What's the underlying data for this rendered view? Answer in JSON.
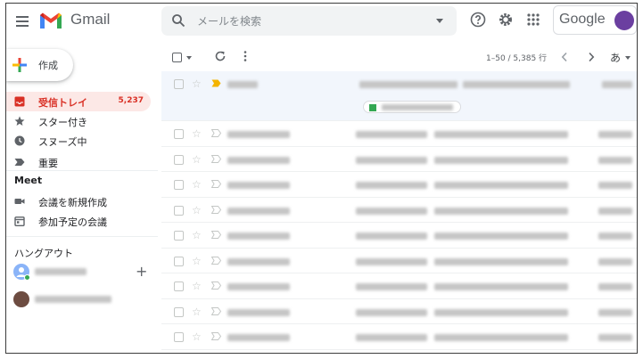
{
  "app": {
    "name": "Gmail"
  },
  "search": {
    "placeholder": "メールを検索"
  },
  "account": {
    "brand": "Google",
    "avatar_initial": ""
  },
  "sidebar": {
    "compose_label": "作成",
    "items": [
      {
        "label": "受信トレイ",
        "count": "5,237",
        "active": true,
        "icon": "inbox-icon"
      },
      {
        "label": "スター付き",
        "icon": "star-icon"
      },
      {
        "label": "スヌーズ中",
        "icon": "clock-icon"
      },
      {
        "label": "重要",
        "icon": "label-important-icon"
      }
    ],
    "meet": {
      "title": "Meet",
      "items": [
        {
          "label": "会議を新規作成",
          "icon": "video-icon"
        },
        {
          "label": "参加予定の会議",
          "icon": "calendar-icon"
        }
      ]
    },
    "hangouts": {
      "title": "ハングアウト"
    }
  },
  "toolbar": {
    "pager": "1–50 / 5,385 行",
    "input_tool": "あ"
  },
  "colors": {
    "accent": "#d93025",
    "active_bg": "#fce8e6",
    "search_bg": "#f1f3f4",
    "important": "#f4b400"
  }
}
